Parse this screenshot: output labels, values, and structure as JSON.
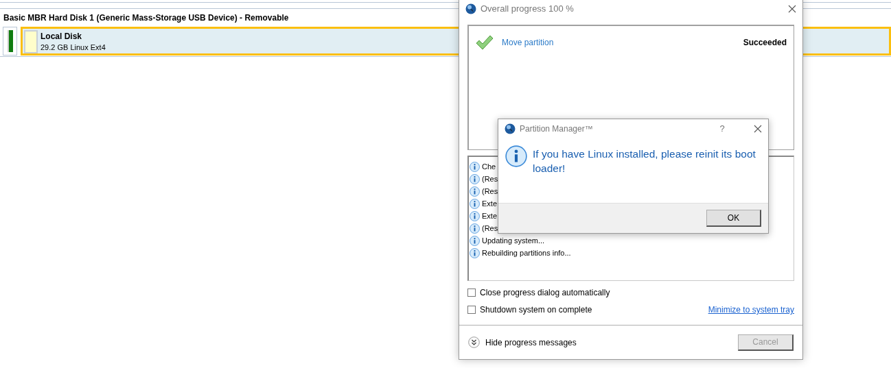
{
  "disk": {
    "title": "Basic MBR Hard Disk 1 (Generic Mass-Storage USB Device) - Removable",
    "partition": {
      "name": "Local Disk",
      "detail": "29.2 GB Linux Ext4",
      "selected": true
    }
  },
  "progress_dialog": {
    "title": "Overall progress 100 %",
    "operations": [
      {
        "name": "Move partition",
        "status": "Succeeded"
      }
    ],
    "log": [
      {
        "text": "Che"
      },
      {
        "text": "(Res"
      },
      {
        "text": "(Res"
      },
      {
        "text": "Exte"
      },
      {
        "text": "Exte"
      },
      {
        "text": "(Res"
      },
      {
        "text": "Updating system..."
      },
      {
        "text": "Rebuilding partitions info..."
      }
    ],
    "options": [
      {
        "label": "Close progress dialog automatically",
        "checked": false
      },
      {
        "label": "Shutdown system on complete",
        "checked": false
      }
    ],
    "link": "Minimize to system tray",
    "toggle": "Hide progress messages",
    "cancel": {
      "label": "Cancel",
      "disabled": true
    }
  },
  "message_box": {
    "title": "Partition Manager™",
    "help": "?",
    "message": "If you have Linux installed, please reinit its boot loader!",
    "ok": "OK"
  }
}
